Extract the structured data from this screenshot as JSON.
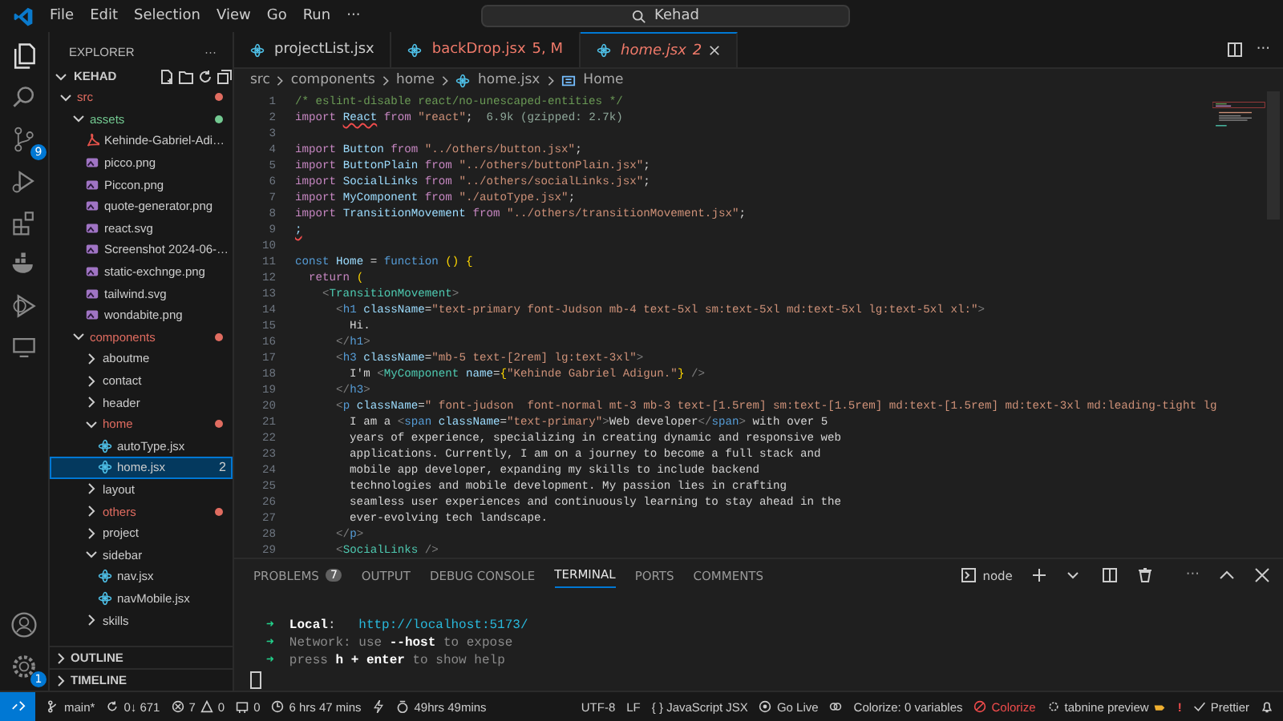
{
  "title_bar": {
    "menus": [
      "File",
      "Edit",
      "Selection",
      "View",
      "Go",
      "Run",
      "···"
    ],
    "search": "Kehad"
  },
  "activity_bar": {
    "source_control_badge": "9",
    "settings_badge": "1"
  },
  "sidebar": {
    "title": "EXPLORER",
    "more": "···",
    "root": "KEHAD",
    "tree": [
      {
        "name": "src",
        "kind": "folder",
        "expanded": true,
        "color": "#e06c60",
        "selected": false,
        "children": [
          {
            "name": "assets",
            "kind": "folder",
            "expanded": true,
            "color": "#73c991",
            "selected": false,
            "children": [
              {
                "name": "Kehinde-Gabriel-Adi…",
                "kind": "pdf",
                "selected": false
              },
              {
                "name": "picco.png",
                "kind": "image",
                "selected": false
              },
              {
                "name": "Piccon.png",
                "kind": "image",
                "selected": false
              },
              {
                "name": "quote-generator.png",
                "kind": "image",
                "selected": false
              },
              {
                "name": "react.svg",
                "kind": "svg",
                "selected": false
              },
              {
                "name": "Screenshot 2024-06-…",
                "kind": "image",
                "selected": false
              },
              {
                "name": "static-exchnge.png",
                "kind": "image",
                "selected": false
              },
              {
                "name": "tailwind.svg",
                "kind": "svg",
                "selected": false
              },
              {
                "name": "wondabite.png",
                "kind": "image",
                "selected": false
              }
            ]
          },
          {
            "name": "components",
            "kind": "folder",
            "expanded": true,
            "color": "#e06c60",
            "selected": false,
            "children": [
              {
                "name": "aboutme",
                "kind": "folder",
                "expanded": false,
                "selected": false
              },
              {
                "name": "contact",
                "kind": "folder",
                "expanded": false,
                "selected": false
              },
              {
                "name": "header",
                "kind": "folder",
                "expanded": false,
                "selected": false
              },
              {
                "name": "home",
                "kind": "folder",
                "expanded": true,
                "color": "#e06c60",
                "selected": false,
                "children": [
                  {
                    "name": "autoType.jsx",
                    "kind": "jsx",
                    "selected": false
                  },
                  {
                    "name": "home.jsx",
                    "kind": "jsx",
                    "badge": "2",
                    "selected": true
                  }
                ]
              },
              {
                "name": "layout",
                "kind": "folder",
                "expanded": false,
                "selected": false
              },
              {
                "name": "others",
                "kind": "folder",
                "expanded": false,
                "color": "#e06c60",
                "selected": false
              },
              {
                "name": "project",
                "kind": "folder",
                "expanded": false,
                "selected": false
              },
              {
                "name": "sidebar",
                "kind": "folder",
                "expanded": true,
                "selected": false,
                "children": [
                  {
                    "name": "nav.jsx",
                    "kind": "jsx",
                    "selected": false
                  },
                  {
                    "name": "navMobile.jsx",
                    "kind": "jsx",
                    "selected": false
                  }
                ]
              },
              {
                "name": "skills",
                "kind": "folder",
                "expanded": false,
                "selected": false
              }
            ]
          }
        ]
      }
    ],
    "sections": [
      {
        "label": "OUTLINE",
        "expanded": false
      },
      {
        "label": "TIMELINE",
        "expanded": false
      }
    ]
  },
  "tabs": [
    {
      "label": "projectList.jsx",
      "errors": false,
      "preview": false,
      "selected": false
    },
    {
      "label": "backDrop.jsx",
      "suffix": "5, M",
      "errors": true,
      "preview": false,
      "selected": false
    },
    {
      "label": "home.jsx",
      "suffix": "2",
      "errors": true,
      "preview": true,
      "selected": true
    }
  ],
  "breadcrumb": [
    "src",
    "components",
    "home",
    "home.jsx",
    "Home"
  ],
  "code": [
    {
      "number": "1",
      "tokens": [
        {
          "kind": "comment",
          "text": "/* eslint-disable react/no-unescaped-entities */"
        }
      ]
    },
    {
      "number": "2",
      "tokens": [
        {
          "kind": "keyword",
          "text": "import "
        },
        {
          "kind": "error",
          "text": "React"
        },
        {
          "kind": "keyword",
          "text": " from "
        },
        {
          "kind": "string",
          "text": "\"react\""
        },
        {
          "kind": "plain",
          "text": ";"
        },
        {
          "kind": "hint",
          "text": "  6.9k (gzipped: 2.7k)"
        }
      ]
    },
    {
      "number": "3"
    },
    {
      "number": "4",
      "tokens": [
        {
          "kind": "keyword",
          "text": "import "
        },
        {
          "kind": "variable",
          "text": "Button"
        },
        {
          "kind": "keyword",
          "text": " from "
        },
        {
          "kind": "string",
          "text": "\"../others/button.jsx\""
        },
        {
          "kind": "plain",
          "text": ";"
        }
      ]
    },
    {
      "number": "5",
      "tokens": [
        {
          "kind": "keyword",
          "text": "import "
        },
        {
          "kind": "variable",
          "text": "ButtonPlain"
        },
        {
          "kind": "keyword",
          "text": " from "
        },
        {
          "kind": "string",
          "text": "\"../others/buttonPlain.jsx\""
        },
        {
          "kind": "plain",
          "text": ";"
        }
      ]
    },
    {
      "number": "6",
      "tokens": [
        {
          "kind": "keyword",
          "text": "import "
        },
        {
          "kind": "variable",
          "text": "SocialLinks"
        },
        {
          "kind": "keyword",
          "text": " from "
        },
        {
          "kind": "string",
          "text": "\"../others/socialLinks.jsx\""
        },
        {
          "kind": "plain",
          "text": ";"
        }
      ]
    },
    {
      "number": "7",
      "tokens": [
        {
          "kind": "keyword",
          "text": "import "
        },
        {
          "kind": "variable",
          "text": "MyComponent"
        },
        {
          "kind": "keyword",
          "text": " from "
        },
        {
          "kind": "string",
          "text": "\"./autoType.jsx\""
        },
        {
          "kind": "plain",
          "text": ";"
        }
      ]
    },
    {
      "number": "8",
      "tokens": [
        {
          "kind": "keyword",
          "text": "import "
        },
        {
          "kind": "variable",
          "text": "TransitionMovement"
        },
        {
          "kind": "keyword",
          "text": " from "
        },
        {
          "kind": "string",
          "text": "\"../others/transitionMovement.jsx\""
        },
        {
          "kind": "plain",
          "text": ";"
        }
      ]
    },
    {
      "number": "9",
      "tokens": [
        {
          "kind": "error",
          "text": ";"
        }
      ]
    },
    {
      "number": "10"
    },
    {
      "number": "11",
      "tokens": [
        {
          "kind": "storage",
          "text": "const "
        },
        {
          "kind": "variable",
          "text": "Home"
        },
        {
          "kind": "plain",
          "text": " = "
        },
        {
          "kind": "storage",
          "text": "function "
        },
        {
          "kind": "brace",
          "text": "() {"
        }
      ]
    },
    {
      "number": "12",
      "tokens": [
        {
          "kind": "keyword",
          "text": "  return "
        },
        {
          "kind": "brace",
          "text": "("
        }
      ]
    },
    {
      "number": "13",
      "tokens": [
        {
          "kind": "punct",
          "text": "    <"
        },
        {
          "kind": "component",
          "text": "TransitionMovement"
        },
        {
          "kind": "punct",
          "text": ">"
        }
      ]
    },
    {
      "number": "14",
      "tokens": [
        {
          "kind": "punct",
          "text": "      <"
        },
        {
          "kind": "tag",
          "text": "h1"
        },
        {
          "kind": "attr",
          "text": " className"
        },
        {
          "kind": "plain",
          "text": "="
        },
        {
          "kind": "string",
          "text": "\"text-primary font-Judson mb-4 text-5xl sm:text-5xl md:text-5xl lg:text-5xl xl:\""
        },
        {
          "kind": "punct",
          "text": ">"
        }
      ]
    },
    {
      "number": "15",
      "tokens": [
        {
          "kind": "plain",
          "text": "        Hi."
        }
      ]
    },
    {
      "number": "16",
      "tokens": [
        {
          "kind": "punct",
          "text": "      </"
        },
        {
          "kind": "tag",
          "text": "h1"
        },
        {
          "kind": "punct",
          "text": ">"
        }
      ]
    },
    {
      "number": "17",
      "tokens": [
        {
          "kind": "punct",
          "text": "      <"
        },
        {
          "kind": "tag",
          "text": "h3"
        },
        {
          "kind": "attr",
          "text": " className"
        },
        {
          "kind": "plain",
          "text": "="
        },
        {
          "kind": "string",
          "text": "\"mb-5 text-[2rem] lg:text-3xl\""
        },
        {
          "kind": "punct",
          "text": ">"
        }
      ]
    },
    {
      "number": "18",
      "tokens": [
        {
          "kind": "plain",
          "text": "        I'm "
        },
        {
          "kind": "punct",
          "text": "<"
        },
        {
          "kind": "component",
          "text": "MyComponent"
        },
        {
          "kind": "attr",
          "text": " name"
        },
        {
          "kind": "plain",
          "text": "="
        },
        {
          "kind": "brace",
          "text": "{"
        },
        {
          "kind": "string",
          "text": "\"Kehinde Gabriel Adigun.\""
        },
        {
          "kind": "brace",
          "text": "}"
        },
        {
          "kind": "punct",
          "text": " />"
        }
      ]
    },
    {
      "number": "19",
      "tokens": [
        {
          "kind": "punct",
          "text": "      </"
        },
        {
          "kind": "tag",
          "text": "h3"
        },
        {
          "kind": "punct",
          "text": ">"
        }
      ]
    },
    {
      "number": "20",
      "tokens": [
        {
          "kind": "punct",
          "text": "      <"
        },
        {
          "kind": "tag",
          "text": "p"
        },
        {
          "kind": "attr",
          "text": " className"
        },
        {
          "kind": "plain",
          "text": "="
        },
        {
          "kind": "string",
          "text": "\" font-judson  font-normal mt-3 mb-3 text-[1.5rem] sm:text-[1.5rem] md:text-[1.5rem] md:text-3xl md:leading-tight lg"
        }
      ]
    },
    {
      "number": "21",
      "tokens": [
        {
          "kind": "plain",
          "text": "        I am a "
        },
        {
          "kind": "punct",
          "text": "<"
        },
        {
          "kind": "tag",
          "text": "span"
        },
        {
          "kind": "attr",
          "text": " className"
        },
        {
          "kind": "plain",
          "text": "="
        },
        {
          "kind": "string",
          "text": "\"text-primary\""
        },
        {
          "kind": "punct",
          "text": ">"
        },
        {
          "kind": "plain",
          "text": "Web developer"
        },
        {
          "kind": "punct",
          "text": "</"
        },
        {
          "kind": "tag",
          "text": "span"
        },
        {
          "kind": "punct",
          "text": ">"
        },
        {
          "kind": "plain",
          "text": " with over 5"
        }
      ]
    },
    {
      "number": "22",
      "tokens": [
        {
          "kind": "plain",
          "text": "        years of experience, specializing in creating dynamic and responsive web"
        }
      ]
    },
    {
      "number": "23",
      "tokens": [
        {
          "kind": "plain",
          "text": "        applications. Currently, I am on a journey to become a full stack and"
        }
      ]
    },
    {
      "number": "24",
      "tokens": [
        {
          "kind": "plain",
          "text": "        mobile app developer, expanding my skills to include backend"
        }
      ]
    },
    {
      "number": "25",
      "tokens": [
        {
          "kind": "plain",
          "text": "        technologies and mobile development. My passion lies in crafting"
        }
      ]
    },
    {
      "number": "26",
      "tokens": [
        {
          "kind": "plain",
          "text": "        seamless user experiences and continuously learning to stay ahead in the"
        }
      ]
    },
    {
      "number": "27",
      "tokens": [
        {
          "kind": "plain",
          "text": "        ever-evolving tech landscape."
        }
      ]
    },
    {
      "number": "28",
      "tokens": [
        {
          "kind": "punct",
          "text": "      </"
        },
        {
          "kind": "tag",
          "text": "p"
        },
        {
          "kind": "punct",
          "text": ">"
        }
      ]
    },
    {
      "number": "29",
      "tokens": [
        {
          "kind": "punct",
          "text": "      <"
        },
        {
          "kind": "component",
          "text": "SocialLinks"
        },
        {
          "kind": "punct",
          "text": " />"
        }
      ]
    }
  ],
  "panel": {
    "tabs": [
      {
        "label": "PROBLEMS",
        "badge": "7",
        "selected": false
      },
      {
        "label": "OUTPUT",
        "selected": false
      },
      {
        "label": "DEBUG CONSOLE",
        "selected": false
      },
      {
        "label": "TERMINAL",
        "selected": true
      },
      {
        "label": "PORTS",
        "selected": false
      },
      {
        "label": "COMMENTS",
        "selected": false
      }
    ],
    "shell": "node",
    "terminal": [
      [
        {
          "kind": "arrow",
          "text": "➜"
        },
        {
          "kind": "bold",
          "text": "  Local"
        },
        {
          "kind": "plain",
          "text": ":   "
        },
        {
          "kind": "link",
          "text": "http://localhost:5173/"
        }
      ],
      [
        {
          "kind": "arrow",
          "text": "➜"
        },
        {
          "kind": "dim",
          "text": "  Network: use "
        },
        {
          "kind": "bold",
          "text": "--host"
        },
        {
          "kind": "dim",
          "text": " to expose"
        }
      ],
      [
        {
          "kind": "arrow",
          "text": "➜"
        },
        {
          "kind": "dim",
          "text": "  press "
        },
        {
          "kind": "bold",
          "text": "h + enter"
        },
        {
          "kind": "dim",
          "text": " to show help"
        }
      ]
    ]
  },
  "status_bar": {
    "branch": "main*",
    "sync": "0↓ 671",
    "errors": "7",
    "warnings": "0",
    "ports": "0",
    "session_time": "6 hrs 47 mins",
    "total_time": "49hrs 49mins",
    "right": [
      {
        "kind": "plain",
        "text": "UTF-8"
      },
      {
        "kind": "plain",
        "text": "LF"
      },
      {
        "kind": "plain",
        "text": "{ } JavaScript JSX"
      },
      {
        "kind": "golive",
        "text": "Go Live"
      },
      {
        "kind": "icon"
      },
      {
        "kind": "plain",
        "text": "Colorize: 0 variables"
      },
      {
        "kind": "colorize",
        "text": "Colorize"
      },
      {
        "kind": "tabnine",
        "text": "tabnine preview"
      },
      {
        "kind": "alert",
        "text": "!"
      },
      {
        "kind": "prettier",
        "text": "Prettier"
      },
      {
        "kind": "bell"
      }
    ]
  }
}
